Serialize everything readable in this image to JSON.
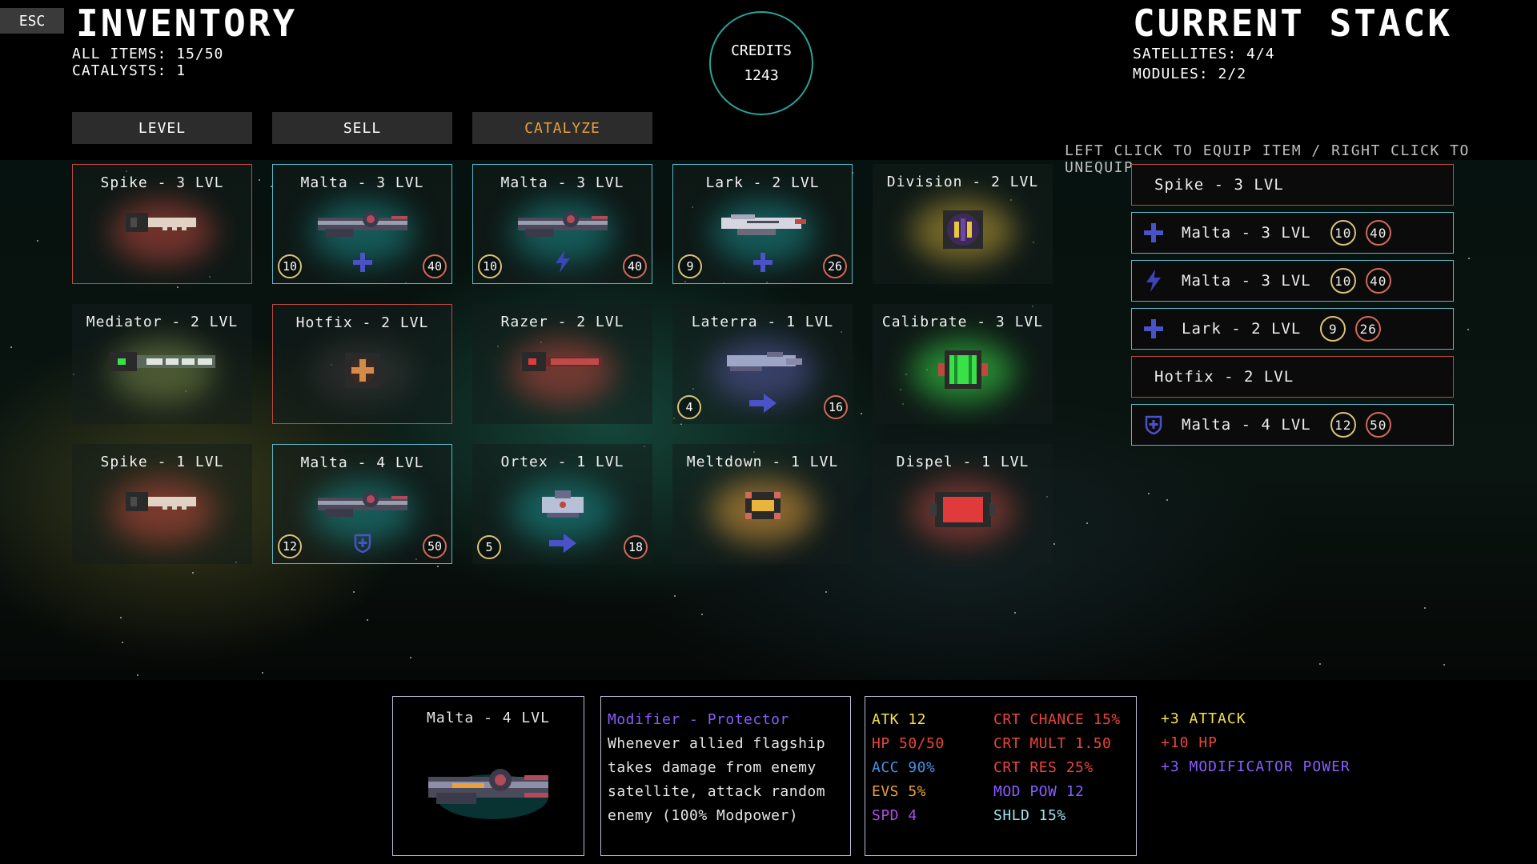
{
  "esc_label": "ESC",
  "header": {
    "inventory_title": "INVENTORY",
    "all_items": "ALL ITEMS: 15/50",
    "catalysts": "CATALYSTS: 1",
    "credits_label": "CREDITS",
    "credits_value": "1243",
    "stack_title": "CURRENT STACK",
    "satellites": "SATELLITES: 4/4",
    "modules": "MODULES: 2/2"
  },
  "tabs": [
    {
      "label": "LEVEL"
    },
    {
      "label": "SELL"
    },
    {
      "label": "CATALYZE"
    }
  ],
  "hint": "LEFT CLICK TO EQUIP ITEM / RIGHT CLICK TO UNEQUIP",
  "inventory": [
    {
      "name": "Spike - 3 LVL",
      "icon": "spike-satellite-icon"
    },
    {
      "name": "Malta - 3 LVL",
      "icon": "malta-satellite-icon",
      "left": "10",
      "right": "40",
      "modifier": "plus-icon"
    },
    {
      "name": "Malta - 3 LVL",
      "icon": "malta-satellite-icon",
      "left": "10",
      "right": "40",
      "modifier": "lightning-icon"
    },
    {
      "name": "Lark - 2 LVL",
      "icon": "lark-satellite-icon",
      "left": "9",
      "right": "26",
      "modifier": "plus-icon"
    },
    {
      "name": "Division - 2 LVL",
      "icon": "division-module-icon"
    },
    {
      "name": "Mediator - 2 LVL",
      "icon": "mediator-satellite-icon"
    },
    {
      "name": "Hotfix - 2 LVL",
      "icon": "hotfix-module-icon"
    },
    {
      "name": "Razer - 2 LVL",
      "icon": "razer-satellite-icon"
    },
    {
      "name": "Laterra - 1 LVL",
      "icon": "laterra-satellite-icon",
      "left": "4",
      "right": "16",
      "modifier": "arrow-right-icon"
    },
    {
      "name": "Calibrate - 3 LVL",
      "icon": "calibrate-module-icon"
    },
    {
      "name": "Spike - 1 LVL",
      "icon": "spike-satellite-icon"
    },
    {
      "name": "Malta - 4 LVL",
      "icon": "malta-satellite-icon",
      "left": "12",
      "right": "50",
      "modifier": "shield-plus-icon"
    },
    {
      "name": "Ortex - 1 LVL",
      "icon": "ortex-satellite-icon",
      "left": "5",
      "right": "18",
      "modifier": "arrow-right-icon"
    },
    {
      "name": "Meltdown - 1 LVL",
      "icon": "meltdown-module-icon"
    },
    {
      "name": "Dispel - 1 LVL",
      "icon": "dispel-module-icon"
    }
  ],
  "current_stack": [
    {
      "name": "Spike - 3 LVL"
    },
    {
      "name": "Malta - 3 LVL",
      "modifier": "plus-icon",
      "left": "10",
      "right": "40"
    },
    {
      "name": "Malta - 3 LVL",
      "modifier": "lightning-icon",
      "left": "10",
      "right": "40"
    },
    {
      "name": "Lark - 2 LVL",
      "modifier": "plus-icon",
      "left": "9",
      "right": "26"
    },
    {
      "name": "Hotfix - 2 LVL"
    },
    {
      "name": "Malta - 4 LVL",
      "modifier": "shield-plus-icon",
      "left": "12",
      "right": "50"
    }
  ],
  "detail": {
    "name": "Malta - 4 LVL",
    "modifier_title": "Modifier - Protector",
    "description": [
      "Whenever allied flagship",
      "takes damage from enemy",
      "satellite, attack random",
      "enemy (100% Modpower)"
    ],
    "stats_left": [
      {
        "text": "ATK 12",
        "color": "#f2e24a"
      },
      {
        "text": "HP 50/50",
        "color": "#e8453c"
      },
      {
        "text": "ACC 90%",
        "color": "#4a90e8"
      },
      {
        "text": "EVS 5%",
        "color": "#e8a13c"
      },
      {
        "text": "SPD 4",
        "color": "#b04ae8"
      }
    ],
    "stats_right": [
      {
        "text": "CRT CHANCE 15%",
        "color": "#e8453c"
      },
      {
        "text": "CRT MULT 1.50",
        "color": "#e8453c"
      },
      {
        "text": "CRT RES 25%",
        "color": "#e8453c"
      },
      {
        "text": "MOD POW 12",
        "color": "#8a5cff"
      },
      {
        "text": "SHLD 15%",
        "color": "#9be3ee"
      }
    ],
    "bonuses": [
      {
        "text": "+3 ATTACK",
        "color": "#f2e24a"
      },
      {
        "text": "+10 HP",
        "color": "#e8453c"
      },
      {
        "text": "+3 MODIFICATOR POWER",
        "color": "#8a5cff"
      }
    ]
  }
}
